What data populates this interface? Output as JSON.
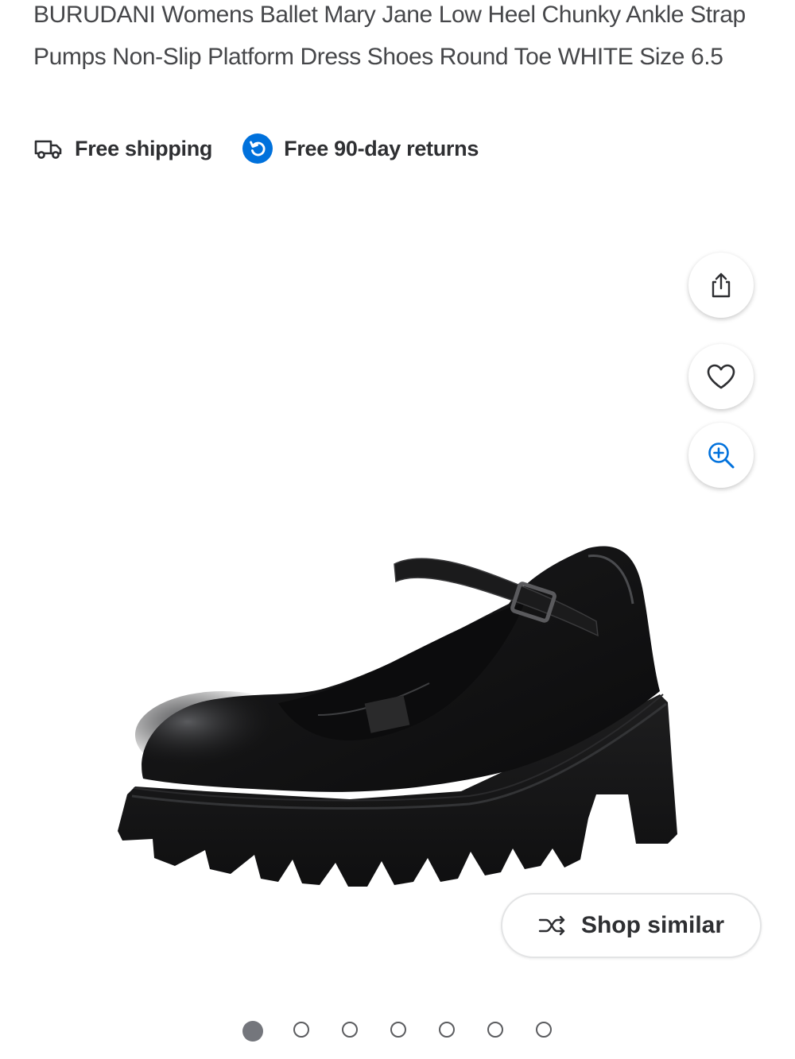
{
  "product": {
    "title": "BURUDANI Womens Ballet Mary Jane Low Heel Chunky Ankle Strap Pumps Non-Slip Platform Dress Shoes Round Toe WHITE Size 6.5"
  },
  "badges": {
    "shipping": {
      "label": "Free shipping",
      "icon": "truck-icon"
    },
    "returns": {
      "label": "Free 90-day returns",
      "icon": "returns-icon",
      "color": "#0071dc"
    }
  },
  "actions": {
    "share_icon": "share-icon",
    "favorite_icon": "heart-icon",
    "zoom_icon": "zoom-in-icon",
    "zoom_color": "#0071dc"
  },
  "shop_similar": {
    "label": "Shop similar",
    "icon": "shuffle-icon"
  },
  "carousel": {
    "total": 7,
    "active_index": 0
  }
}
